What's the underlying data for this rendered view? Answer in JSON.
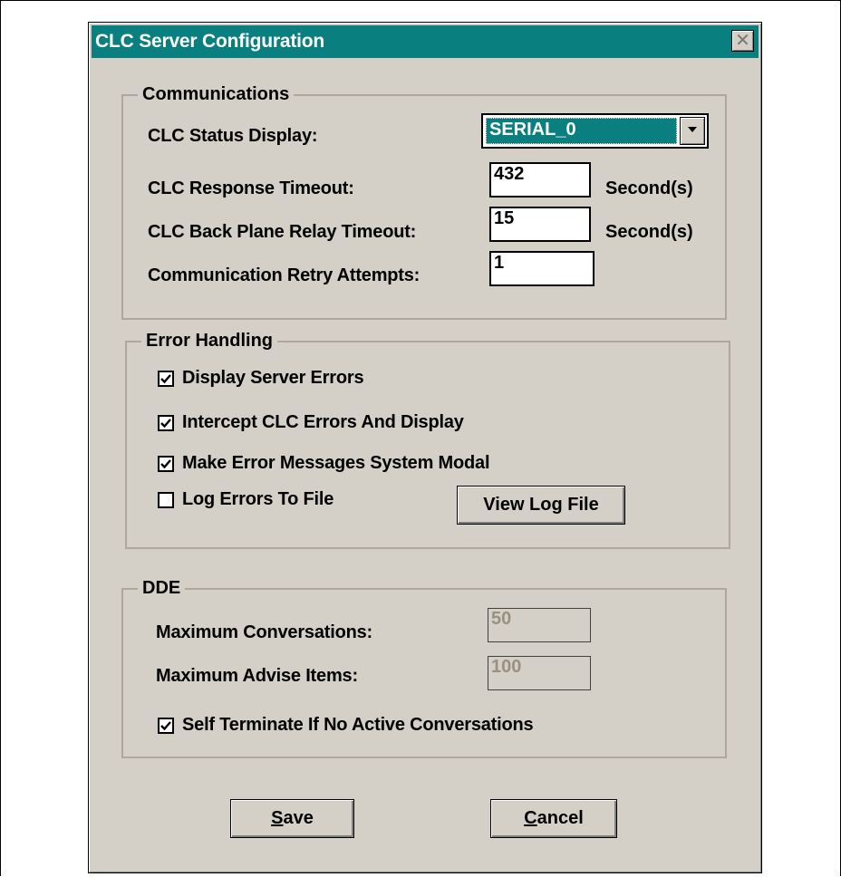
{
  "window": {
    "title": "CLC Server Configuration",
    "close_icon": "close-icon"
  },
  "communications": {
    "group_label": "Communications",
    "status_display_label": "CLC Status Display:",
    "status_display_value": "SERIAL_0",
    "response_timeout_label": "CLC Response Timeout:",
    "response_timeout_value": "432",
    "response_timeout_unit": "Second(s)",
    "backplane_timeout_label": "CLC Back Plane Relay Timeout:",
    "backplane_timeout_value": "15",
    "backplane_timeout_unit": "Second(s)",
    "retry_label": "Communication Retry Attempts:",
    "retry_value": "1"
  },
  "error_handling": {
    "group_label": "Error Handling",
    "display_server_errors": {
      "label": "Display Server Errors",
      "checked": true
    },
    "intercept_clc_errors": {
      "label": "Intercept CLC Errors And Display",
      "checked": true
    },
    "system_modal": {
      "label": "Make Error Messages System Modal",
      "checked": true
    },
    "log_errors": {
      "label": "Log Errors To File",
      "checked": false
    },
    "view_log_button": "View Log File"
  },
  "dde": {
    "group_label": "DDE",
    "max_conversations_label": "Maximum Conversations:",
    "max_conversations_value": "50",
    "max_advise_label": "Maximum Advise Items:",
    "max_advise_value": "100",
    "self_terminate": {
      "label": "Self Terminate If No Active Conversations",
      "checked": true
    }
  },
  "buttons": {
    "save_mnemonic": "S",
    "save_rest": "ave",
    "cancel_mnemonic": "C",
    "cancel_rest": "ancel"
  },
  "colors": {
    "title_bar": "#0a7f7f",
    "dialog_face": "#d4d0c8",
    "disabled_text": "#9a8f80"
  }
}
